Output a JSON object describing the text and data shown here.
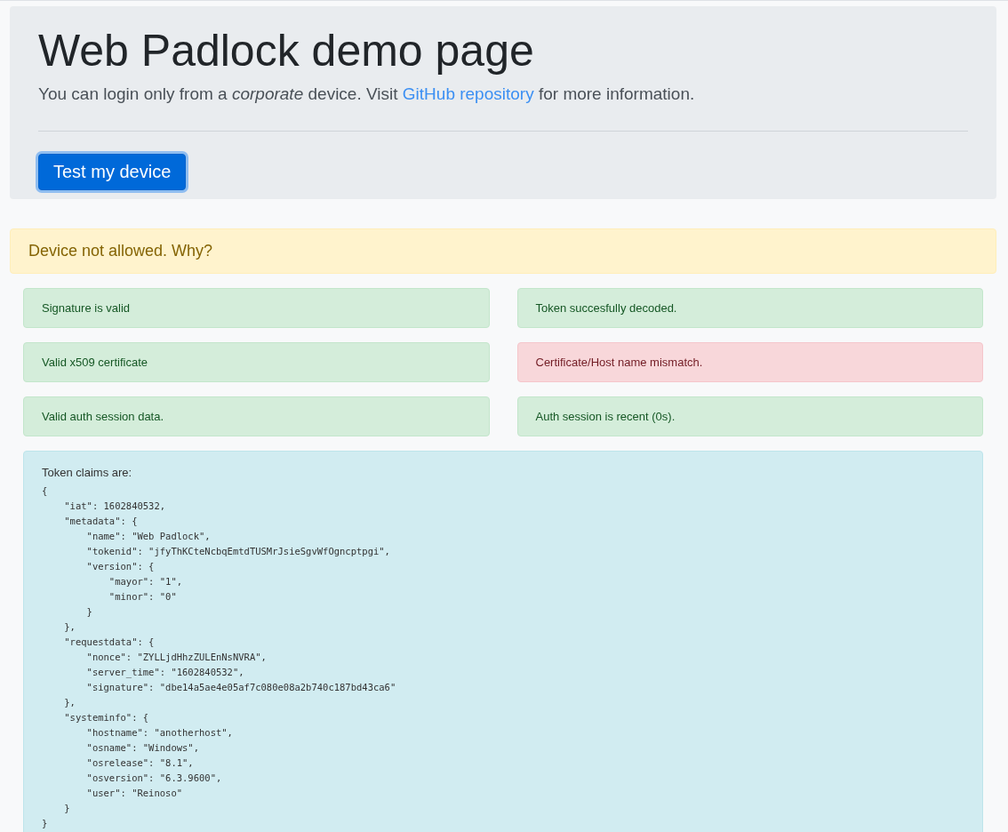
{
  "jumbotron": {
    "title": "Web Padlock demo page",
    "lead": {
      "before": "You can login only from a *corporate* device. Visit ",
      "link": "GitHub repository",
      "after": " for more information."
    },
    "button": {
      "label": "Test my device",
      "focused": true
    }
  },
  "alert": {
    "kind": "warning",
    "text": "Device not allowed. Why?"
  },
  "checks": [
    {
      "kind": "success",
      "text": "Signature is valid"
    },
    {
      "kind": "success",
      "text": "Token succesfully decoded."
    },
    {
      "kind": "success",
      "text": "Valid x509 certificate"
    },
    {
      "kind": "danger",
      "text": "Certificate/Host name mismatch."
    },
    {
      "kind": "success",
      "text": "Valid auth session data."
    },
    {
      "kind": "success",
      "text": "Auth session is recent (0s)."
    }
  ],
  "token_claims": {
    "heading": "Token claims are:",
    "code": "{\n    \"iat\": 1602840532,\n    \"metadata\": {\n        \"name\": \"Web Padlock\",\n        \"tokenid\": \"jfyThKCteNcbqEmtdTUSMrJsieSgvWfOgncptpgi\",\n        \"version\": {\n            \"mayor\": \"1\",\n            \"minor\": \"0\"\n        }\n    },\n    \"requestdata\": {\n        \"nonce\": \"ZYLLjdHhzZULEnNsNVRA\",\n        \"server_time\": \"1602840532\",\n        \"signature\": \"dbe14a5ae4e05af7c080e08a2b740c187bd43ca6\"\n    },\n    \"systeminfo\": {\n        \"hostname\": \"anotherhost\",\n        \"osname\": \"Windows\",\n        \"osrelease\": \"8.1\",\n        \"osversion\": \"6.3.9600\",\n        \"user\": \"Reinoso\"\n    }\n}"
  }
}
